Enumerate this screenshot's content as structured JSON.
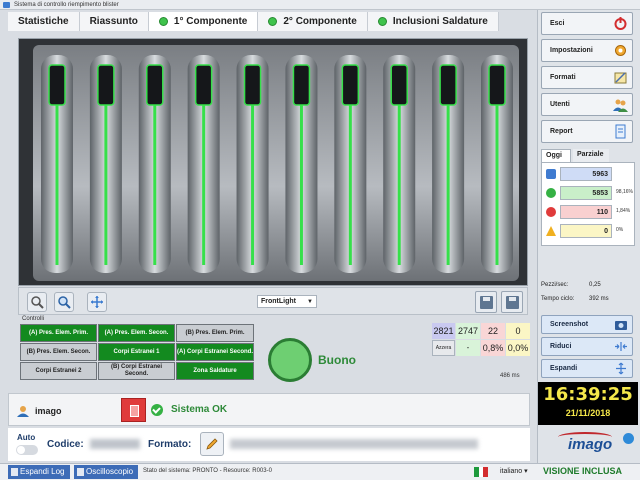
{
  "window": {
    "title": "Sistema di controllo riempimento blister"
  },
  "tabs": [
    {
      "label": "Statistiche",
      "dot": false
    },
    {
      "label": "Riassunto",
      "dot": false
    },
    {
      "label": "1° Componente",
      "dot": true
    },
    {
      "label": "2° Componente",
      "dot": true
    },
    {
      "label": "Inclusioni Saldature",
      "dot": true
    }
  ],
  "camera": {
    "light_mode": "FrontLight",
    "blister_count": 10
  },
  "controls": {
    "label": "Controlli",
    "cells": [
      {
        "text": "(A) Pres. Elem. Prim.",
        "state": "green"
      },
      {
        "text": "(A) Pres. Elem. Secon.",
        "state": "green"
      },
      {
        "text": "(B) Pres. Elem. Prim.",
        "state": "grey"
      },
      {
        "text": "(B) Pres. Elem. Secon.",
        "state": "grey"
      },
      {
        "text": "Corpi Estranei 1",
        "state": "green"
      },
      {
        "text": "(A) Corpi Estranei Second.",
        "state": "green"
      },
      {
        "text": "Corpi Estranei 2",
        "state": "grey"
      },
      {
        "text": "(B) Corpi Estranei Second.",
        "state": "grey"
      },
      {
        "text": "Zona Saldature",
        "state": "green"
      }
    ]
  },
  "result": {
    "label": "Buono",
    "color": "#6ecf72"
  },
  "counters": {
    "total": "2821",
    "good": "2747",
    "bad": "22",
    "warn": "0",
    "reset_label": "Azzera",
    "good_pct": "-",
    "bad_pct": "0,8%",
    "warn_pct": "0,0%",
    "time": "486 ms"
  },
  "user": {
    "name": "imago"
  },
  "system_status": {
    "label": "Sistema OK"
  },
  "format": {
    "auto_label": "Auto",
    "codice_label": "Codice:",
    "formato_label": "Formato:"
  },
  "statusbar": {
    "log_button": "Espandi Log",
    "osc_button": "Oscilloscopio",
    "state": "Stato del sistema: PRONTO - Resource: R003-0",
    "language": "italiano",
    "version": "VISIONE INCLUSA"
  },
  "menu": {
    "esci": "Esci",
    "impostazioni": "Impostazioni",
    "formati": "Formati",
    "utenti": "Utenti",
    "report": "Report",
    "screenshot": "Screenshot",
    "riduci": "Riduci",
    "espandi": "Espandi"
  },
  "stats": {
    "tab_today": "Oggi",
    "tab_partial": "Parziale",
    "total": "5963",
    "good": "5853",
    "good_pct": "98,16%",
    "bad": "110",
    "bad_pct": "1,84%",
    "warn": "0",
    "warn_pct": "0%",
    "pezzi_label": "Pezzi/sec:",
    "pezzi_value": "0,25",
    "tempo_label": "Tempo ciclo:",
    "tempo_value": "392 ms"
  },
  "clock": {
    "time": "16:39:25",
    "date": "21/11/2018"
  },
  "brand": {
    "logo": "imago"
  },
  "colors": {
    "ok_green": "#2e8a39",
    "control_green": "#138a1f",
    "accent_blue": "#3d6cb7"
  }
}
